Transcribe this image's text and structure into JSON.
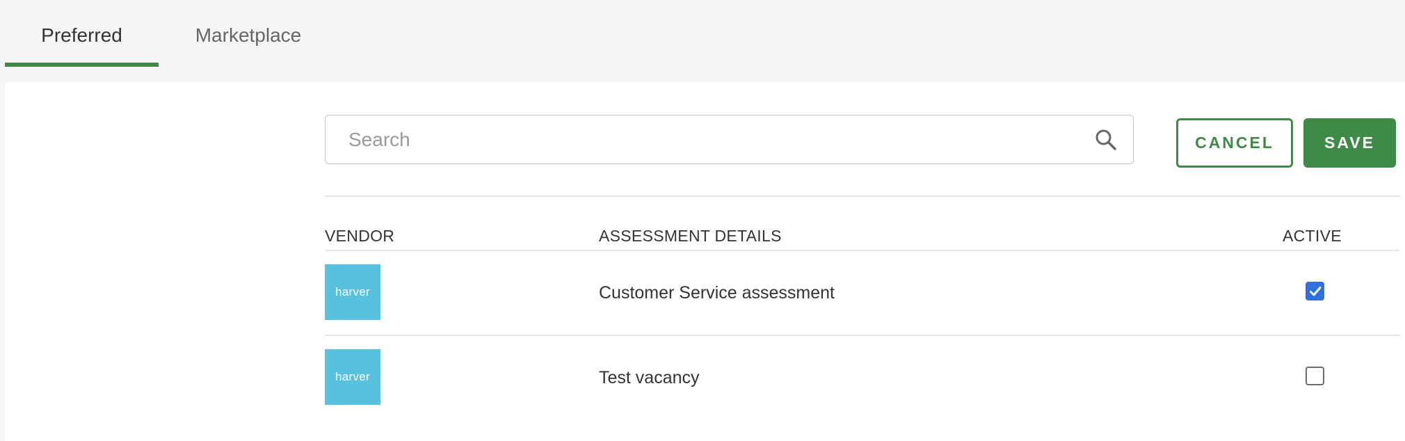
{
  "tabs": [
    {
      "label": "Preferred",
      "active": true
    },
    {
      "label": "Marketplace",
      "active": false
    }
  ],
  "search": {
    "placeholder": "Search",
    "value": ""
  },
  "buttons": {
    "cancel": "CANCEL",
    "save": "SAVE"
  },
  "table": {
    "columns": [
      "VENDOR",
      "ASSESSMENT DETAILS",
      "ACTIVE"
    ],
    "rows": [
      {
        "vendor_logo_text": "harver",
        "details": "Customer Service assessment",
        "active": true
      },
      {
        "vendor_logo_text": "harver",
        "details": "Test vacancy",
        "active": false
      }
    ]
  },
  "colors": {
    "accent": "#3f8a46",
    "vendor_logo_bg": "#57c1df",
    "checkbox_checked": "#2f6fe0",
    "page_bg": "#f5f5f3"
  },
  "icons": {
    "search": "search-icon",
    "check": "check-icon"
  }
}
